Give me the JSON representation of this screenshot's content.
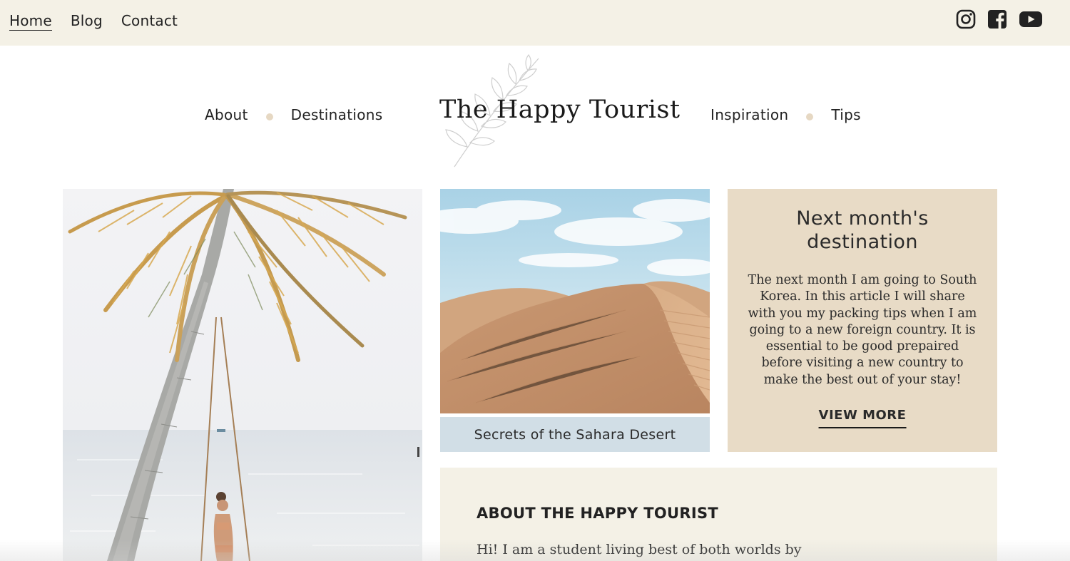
{
  "top_nav": {
    "items": [
      {
        "label": "Home",
        "active": true
      },
      {
        "label": "Blog",
        "active": false
      },
      {
        "label": "Contact",
        "active": false
      }
    ]
  },
  "social": [
    "instagram-icon",
    "facebook-icon",
    "youtube-icon"
  ],
  "main_nav": {
    "left": [
      {
        "label": "About"
      },
      {
        "label": "Destinations"
      }
    ],
    "right": [
      {
        "label": "Inspiration"
      },
      {
        "label": "Tips"
      }
    ]
  },
  "logo": {
    "text": "The Happy Tourist"
  },
  "featured": {
    "caption": "Secrets of the Sahara Desert"
  },
  "next_month": {
    "title": "Next month's destination",
    "body": "The next month I am going to South Korea. In this article I will share with you my packing tips when I am going to a new foreign country. It is essential to be good prepaired before visiting a new country to make the best out of your stay!",
    "button": "VIEW MORE"
  },
  "about": {
    "title": "ABOUT THE HAPPY TOURIST",
    "text": "Hi! I am a student living best of both worlds by"
  },
  "colors": {
    "topbar_bg": "#f4f1e6",
    "caption_bg": "#d1dee6",
    "card_bg": "#e8dbc6",
    "dot": "#e6d8c3"
  }
}
